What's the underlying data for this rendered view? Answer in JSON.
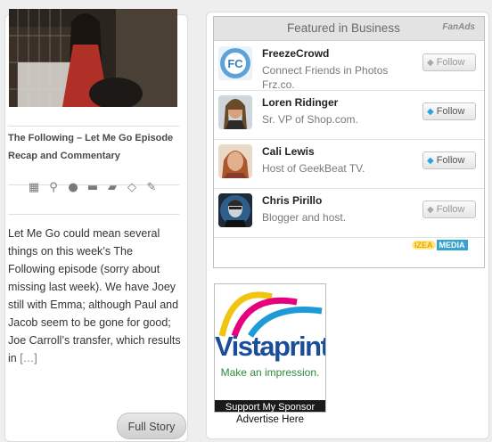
{
  "post": {
    "title": "The Following – Let Me Go Episode Recap and Commentary",
    "excerpt": "Let Me Go could mean several things on this week’s The Following episode (sorry about missing last week).  We have Joey still with Emma; although Paul and Jacob seem to be gone for good; Joe Carroll’s transfer, which results in",
    "more": "[…]",
    "full_story_label": "Full Story",
    "meta_icons": [
      "calendar-icon",
      "link-icon",
      "author-icon",
      "comment-icon",
      "folder-icon",
      "tag-icon",
      "edit-icon"
    ]
  },
  "fanads": {
    "title": "Featured in Business",
    "logo": "FanAds",
    "follow_label": "Follow",
    "items": [
      {
        "name": "FreezeCrowd",
        "desc": "Connect Friends in Photos Frz.co.",
        "follow_dim": true
      },
      {
        "name": "Loren Ridinger",
        "desc": "Sr. VP of Shop.com.",
        "follow_dim": false
      },
      {
        "name": "Cali Lewis",
        "desc": "Host of GeekBeat TV.",
        "follow_dim": false
      },
      {
        "name": "Chris Pirillo",
        "desc": "Blogger and host.",
        "follow_dim": true
      }
    ],
    "izea_izea": "IZEA",
    "izea_media": "MEDIA"
  },
  "sponsor": {
    "brand": "Vistaprint",
    "tagline": "Make an impression.",
    "footer": "Support My Sponsor",
    "advertise": "Advertise Here"
  },
  "colors": {
    "accent_blue": "#1b4e9a",
    "twitter_blue": "#2aa4e0",
    "vista_green": "#2e8a3a"
  }
}
